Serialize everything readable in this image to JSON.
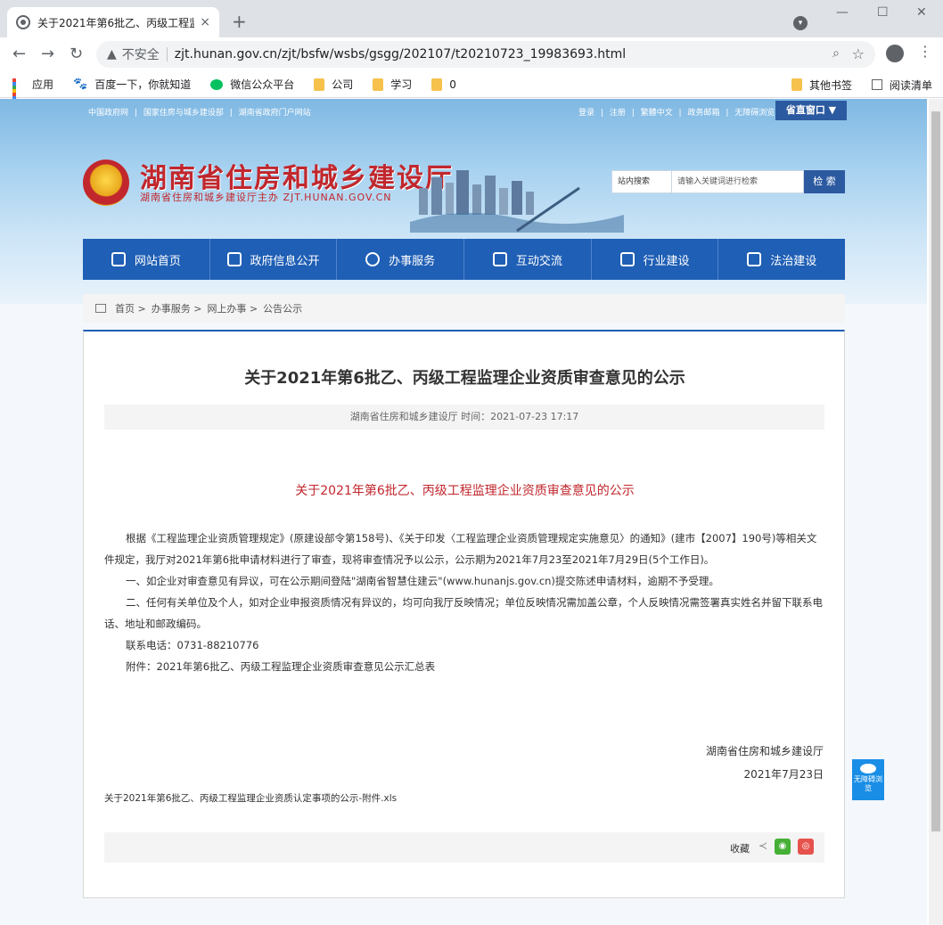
{
  "browser": {
    "tab_title": "关于2021年第6批乙、丙级工程监",
    "tab_close": "×",
    "new_tab": "+",
    "insecure_label": "不安全",
    "url": "zjt.hunan.gov.cn/zjt/bsfw/wsbs/gsgg/202107/t20210723_19983693.html",
    "bookmarks": [
      "应用",
      "百度一下，你就知道",
      "微信公众平台",
      "公司",
      "学习",
      "0"
    ],
    "bookmarks_right": [
      "其他书签",
      "阅读清单"
    ]
  },
  "site": {
    "top_links_left": [
      "中国政府网",
      "|",
      "国家住房与城乡建设部",
      "|",
      "湖南省政府门户网站"
    ],
    "top_links_right": [
      "登录",
      "|",
      "注册",
      "|",
      "繁體中文",
      "|",
      "政务邮箱",
      "|",
      "无障碍浏览"
    ],
    "gateway": "省直窗口 ▼",
    "title": "湖南省住房和城乡建设厅",
    "subtitle": "湖南省住房和城乡建设厅主办 ZJT.HUNAN.GOV.CN",
    "search_scope": "站内搜索",
    "search_placeholder": "请输入关键词进行检索",
    "search_button": "检 索",
    "nav": [
      "网站首页",
      "政府信息公开",
      "办事服务",
      "互动交流",
      "行业建设",
      "法治建设"
    ],
    "breadcrumb": [
      "首页 >",
      "办事服务 >",
      "网上办事 >",
      "公告公示"
    ]
  },
  "article": {
    "title": "关于2021年第6批乙、丙级工程监理企业资质审查意见的公示",
    "meta": "湖南省住房和城乡建设厅  时间：2021-07-23 17:17",
    "red_title": "关于2021年第6批乙、丙级工程监理企业资质审查意见的公示",
    "paragraphs": [
      "根据《工程监理企业资质管理规定》(原建设部令第158号)、《关于印发〈工程监理企业资质管理规定实施意见〉的通知》(建市【2007】190号)等相关文件规定，我厅对2021年第6批申请材料进行了审查，现将审查情况予以公示，公示期为2021年7月23至2021年7月29日(5个工作日)。",
      "一、如企业对审查意见有异议，可在公示期间登陆\"湖南省智慧住建云\"(www.hunanjs.gov.cn)提交陈述申请材料，逾期不予受理。",
      "二、任何有关单位及个人，如对企业申报资质情况有异议的，均可向我厅反映情况；单位反映情况需加盖公章，个人反映情况需签署真实姓名并留下联系电话、地址和邮政编码。",
      "联系电话：0731-88210776",
      "附件：2021年第6批乙、丙级工程监理企业资质审查意见公示汇总表"
    ],
    "sign_org": "湖南省住房和城乡建设厅",
    "sign_date": "2021年7月23日",
    "attachment": "关于2021年第6批乙、丙级工程监理企业资质认定事项的公示-附件.xls",
    "collect": "收藏"
  },
  "a11y_badge": "无障碍浏览"
}
